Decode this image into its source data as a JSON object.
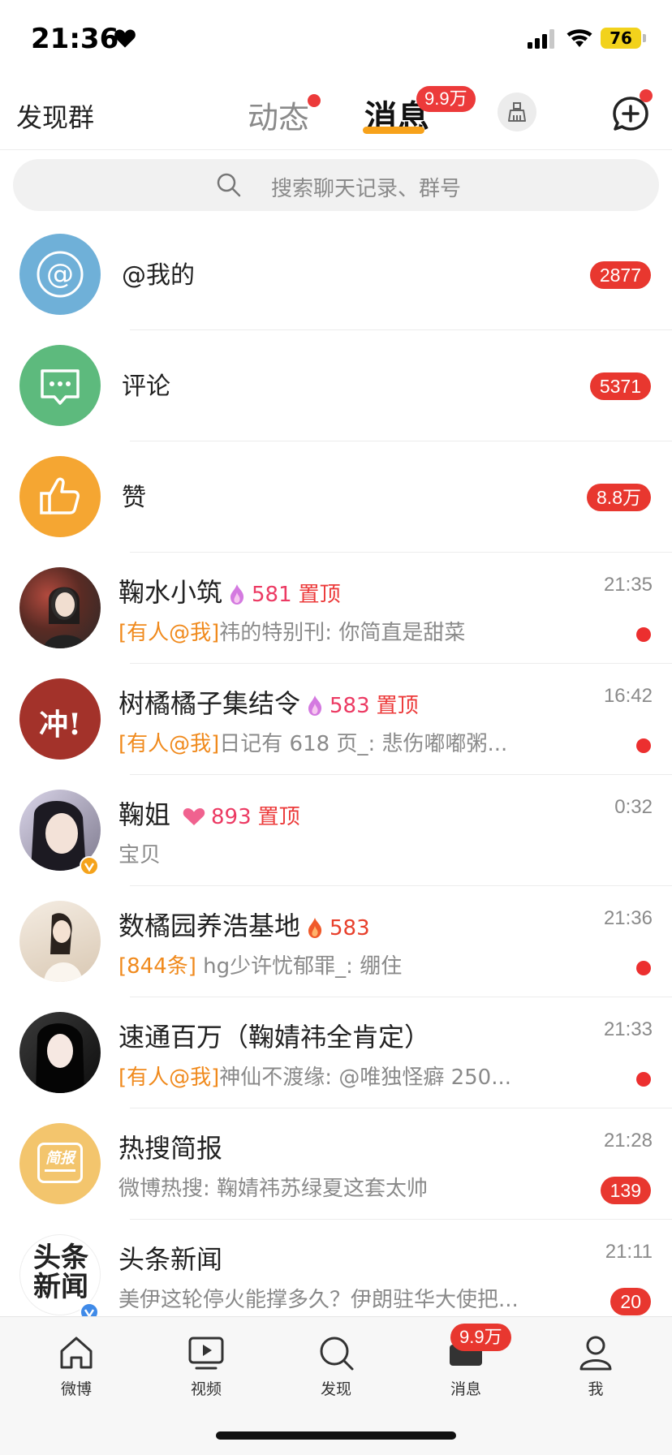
{
  "status": {
    "time": "21:36",
    "battery": "76"
  },
  "header": {
    "discover": "发现群",
    "tab_dynamic": "动态",
    "tab_messages": "消息",
    "messages_badge": "9.9万"
  },
  "search": {
    "placeholder": "搜索聊天记录、群号"
  },
  "system_rows": [
    {
      "label": "@我的",
      "count": "2877",
      "icon": "at-icon",
      "color": "#6fb0d8"
    },
    {
      "label": "评论",
      "count": "5371",
      "icon": "comment-icon",
      "color": "#5dba7d"
    },
    {
      "label": "赞",
      "count": "8.8万",
      "icon": "thumbs-up-icon",
      "color": "#f5a632"
    }
  ],
  "chats": [
    {
      "name": "鞠水小筑",
      "fire": "581",
      "pinned": "置顶",
      "tag": "[有人@我]",
      "preview": "祎的特别刊: 你简直是甜菜",
      "time": "21:35",
      "unread_dot": true
    },
    {
      "name": "树橘橘子集结令",
      "fire": "583",
      "pinned": "置顶",
      "tag": "[有人@我]",
      "preview": "日记有 618 页_: 悲伤嘟嘟粥...",
      "time": "16:42",
      "unread_dot": true,
      "avatar_text": "冲!"
    },
    {
      "name": "鞠姐",
      "fire": "893",
      "pinned": "置顶",
      "tag": "",
      "preview": "宝贝",
      "time": "0:32",
      "unread_dot": false
    },
    {
      "name": "数橘园养浩基地",
      "fire": "583",
      "pinned": "",
      "tag": "[844条]",
      "preview": " hg少许忧郁罪_: 绷住",
      "time": "21:36",
      "unread_dot": true
    },
    {
      "name": "速通百万（鞠婧祎全肯定）",
      "fire": "",
      "pinned": "",
      "tag": "[有人@我]",
      "preview": "神仙不渡缘: @唯独怪癖 250...",
      "time": "21:33",
      "unread_dot": true
    },
    {
      "name": "热搜简报",
      "fire": "",
      "pinned": "",
      "tag": "",
      "preview": "微博热搜: 鞠婧祎苏绿夏这套太帅",
      "time": "21:28",
      "count": "139",
      "avatar_text": "简报"
    },
    {
      "name": "头条新闻",
      "fire": "",
      "pinned": "",
      "tag": "",
      "preview": "美伊这轮停火能撑多久？伊朗驻华大使把...",
      "time": "21:11",
      "count": "20",
      "avatar_text": "头条新闻"
    }
  ],
  "tabbar": {
    "items": [
      "微博",
      "视频",
      "发现",
      "消息",
      "我"
    ],
    "messages_badge": "9.9万"
  },
  "colors": {
    "accent": "#f7a21b",
    "badge": "#e8372f",
    "tag": "#f08a1d"
  }
}
